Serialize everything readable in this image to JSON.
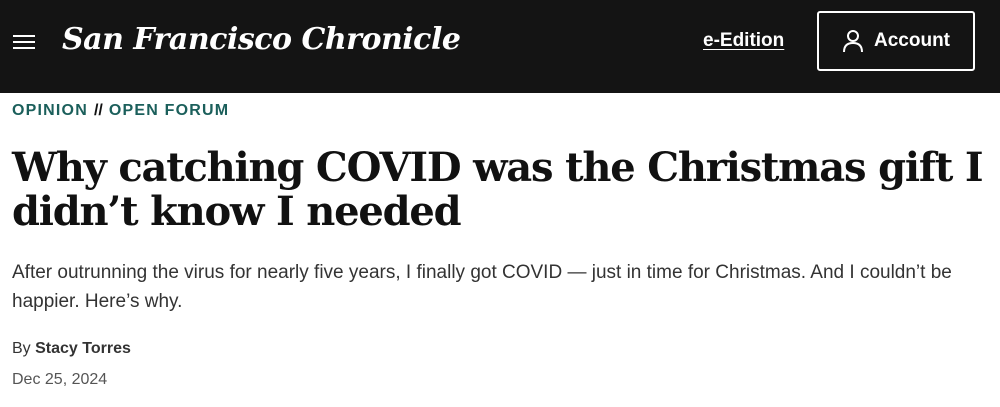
{
  "header": {
    "menu_icon": "hamburger-menu-icon",
    "logo_text": "San Francisco Chronicle",
    "eedition_label": "e-Edition",
    "account_label": "Account",
    "account_icon": "user-icon",
    "background_color": "#141414"
  },
  "article": {
    "kicker": {
      "section": "OPINION",
      "separator": "//",
      "subsection": "OPEN FORUM",
      "color": "#1b5f5b"
    },
    "headline": "Why catching COVID was the Christmas gift I didn’t know I needed",
    "dek": "After outrunning the virus for nearly five years, I finally got COVID — just in time for Christmas. And I couldn’t be happier. Here’s why.",
    "byline_prefix": "By",
    "author": "Stacy Torres",
    "date": "Dec 25, 2024"
  }
}
